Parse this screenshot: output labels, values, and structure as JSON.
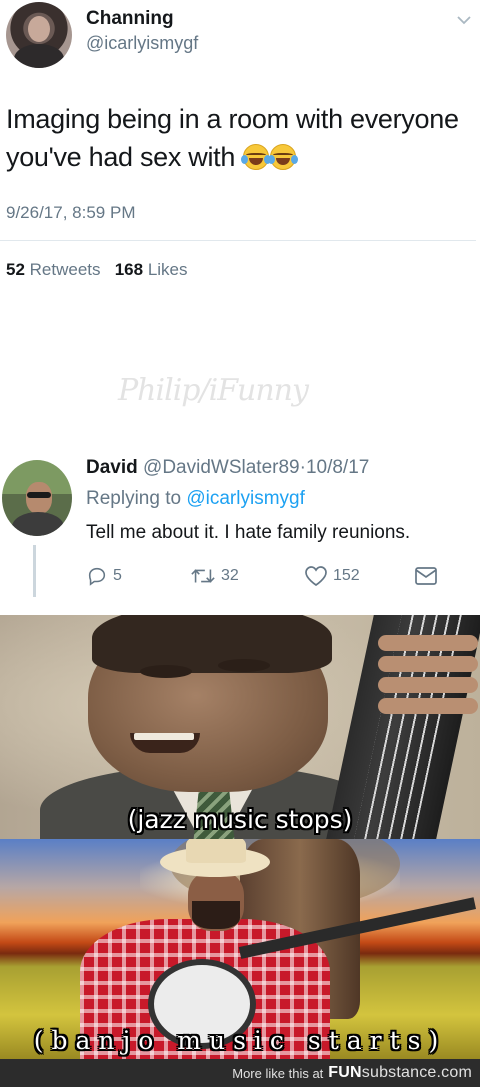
{
  "tweet": {
    "author_name": "Channing",
    "author_handle": "@icarlyismygf",
    "text": "Imaging being in a room with everyone you've had sex with",
    "emoji_icons": [
      "face-with-tears-of-joy-icon",
      "face-with-tears-of-joy-icon"
    ],
    "timestamp": "9/26/17, 8:59 PM",
    "retweets_count": "52",
    "retweets_label": "Retweets",
    "likes_count": "168",
    "likes_label": "Likes"
  },
  "watermark": "Philip/iFunny",
  "reply": {
    "author_name": "David",
    "author_handle": "@DavidWSlater89",
    "separator": "·",
    "date": "10/8/17",
    "replying_label": "Replying to",
    "replying_to": "@icarlyismygf",
    "text": "Tell me about it. I hate family reunions.",
    "reply_count": "5",
    "retweet_count": "32",
    "like_count": "152"
  },
  "meme": {
    "caption_top": "(jazz music stops)",
    "caption_bottom": "(banjo music starts)"
  },
  "footer": {
    "more_text": "More like this at",
    "logo_bold": "FUN",
    "logo_rest": "substance.com"
  },
  "colors": {
    "link_blue": "#1da1f2",
    "muted_gray": "#657786",
    "footer_bg": "#2c2c2c"
  }
}
